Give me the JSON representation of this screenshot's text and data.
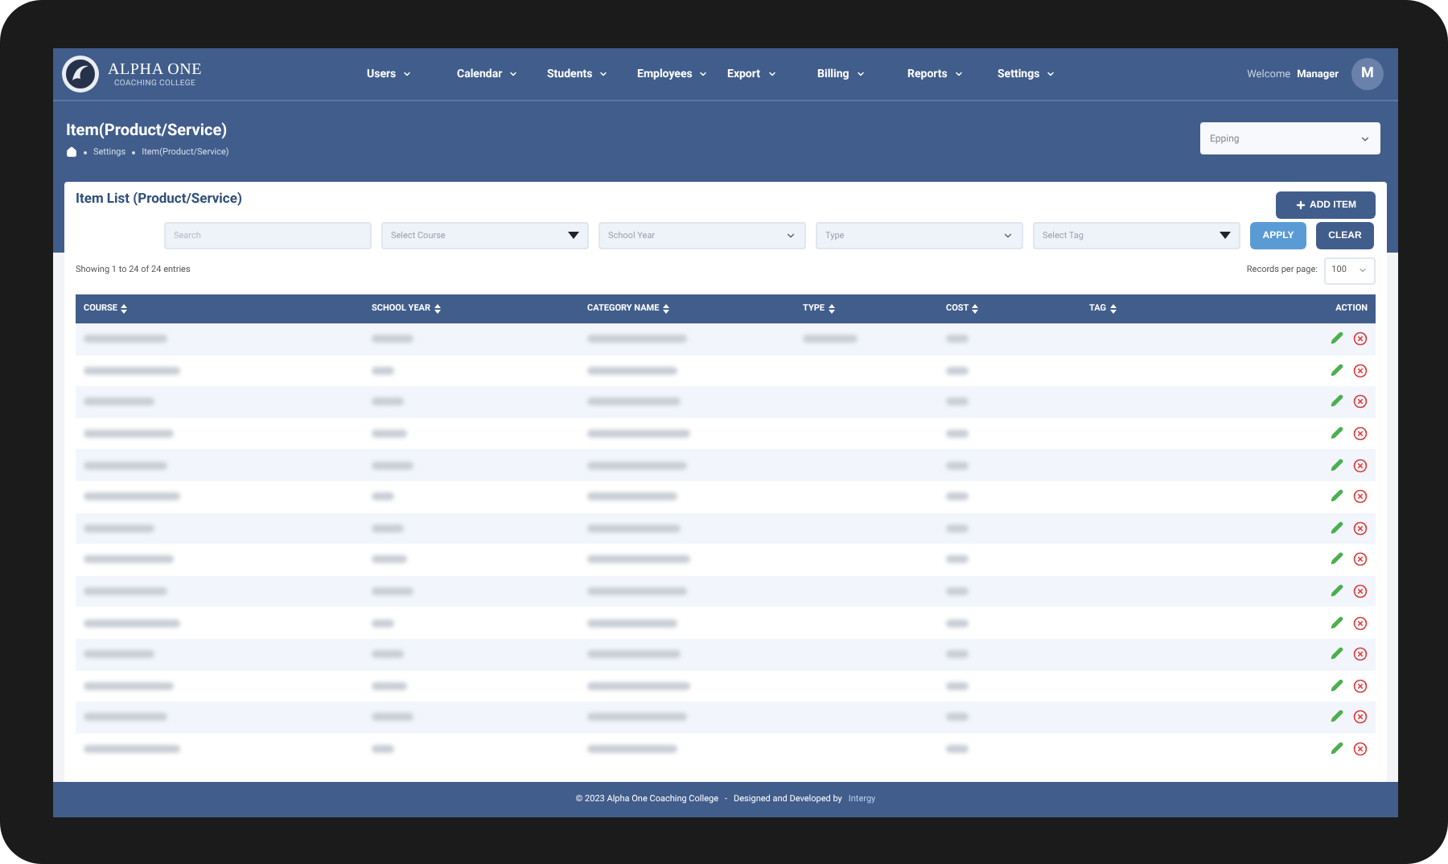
{
  "nav": {
    "brand": "ALPHA ONE",
    "brand_sub": "COACHING COLLEGE",
    "menu": [
      {
        "label": "Users"
      },
      {
        "label": "Calendar"
      },
      {
        "label": "Students"
      },
      {
        "label": "Employees"
      },
      {
        "label": "Export"
      },
      {
        "label": "Billing"
      },
      {
        "label": "Reports"
      },
      {
        "label": "Settings"
      }
    ],
    "welcome": "Welcome",
    "user": "Manager",
    "avatar": "M"
  },
  "page": {
    "title": "Item(Product/Service)",
    "breadcrumb": [
      "Settings",
      "Item(Product/Service)"
    ],
    "location": "Epping"
  },
  "card": {
    "title": "Item List (Product/Service)",
    "add_button": "ADD ITEM",
    "filters": [
      {
        "kind": "input",
        "placeholder": "Search"
      },
      {
        "kind": "solid-select",
        "placeholder": "Select Course"
      },
      {
        "kind": "chevron-select",
        "placeholder": "School Year"
      },
      {
        "kind": "chevron-select",
        "placeholder": "Type"
      },
      {
        "kind": "solid-select",
        "placeholder": "Select Tag"
      }
    ],
    "apply": "APPLY",
    "clear": "CLEAR",
    "showing": "Showing 1 to 24 of 24 entries",
    "records_label": "Records per page:",
    "records_value": "100"
  },
  "table": {
    "columns": [
      {
        "label": "COURSE",
        "sortable": true
      },
      {
        "label": "SCHOOL YEAR",
        "sortable": true
      },
      {
        "label": "CATEGORY NAME",
        "sortable": true
      },
      {
        "label": "TYPE",
        "sortable": true
      },
      {
        "label": "COST",
        "sortable": true
      },
      {
        "label": "TAG",
        "sortable": true
      },
      {
        "label": "ACTION",
        "sortable": false
      }
    ],
    "rows": [
      {
        "cells": [
          {
            "blurred": true
          },
          {
            "blurred": true
          },
          {
            "blurred": true
          },
          {
            "blurred": true
          },
          {
            "blurred": true
          },
          {
            "blurred": false
          }
        ]
      },
      {
        "cells": [
          {
            "blurred": true
          },
          {
            "blurred": true
          },
          {
            "blurred": true
          },
          {
            "blurred": false
          },
          {
            "blurred": true
          },
          {
            "blurred": false
          }
        ]
      },
      {
        "cells": [
          {
            "blurred": true
          },
          {
            "blurred": true
          },
          {
            "blurred": true
          },
          {
            "blurred": false
          },
          {
            "blurred": true
          },
          {
            "blurred": false
          }
        ]
      },
      {
        "cells": [
          {
            "blurred": true
          },
          {
            "blurred": true
          },
          {
            "blurred": true
          },
          {
            "blurred": false
          },
          {
            "blurred": true
          },
          {
            "blurred": false
          }
        ]
      },
      {
        "cells": [
          {
            "blurred": true
          },
          {
            "blurred": true
          },
          {
            "blurred": true
          },
          {
            "blurred": false
          },
          {
            "blurred": true
          },
          {
            "blurred": false
          }
        ]
      },
      {
        "cells": [
          {
            "blurred": true
          },
          {
            "blurred": true
          },
          {
            "blurred": true
          },
          {
            "blurred": false
          },
          {
            "blurred": true
          },
          {
            "blurred": false
          }
        ]
      },
      {
        "cells": [
          {
            "blurred": true
          },
          {
            "blurred": true
          },
          {
            "blurred": true
          },
          {
            "blurred": false
          },
          {
            "blurred": true
          },
          {
            "blurred": false
          }
        ]
      },
      {
        "cells": [
          {
            "blurred": true
          },
          {
            "blurred": true
          },
          {
            "blurred": true
          },
          {
            "blurred": false
          },
          {
            "blurred": true
          },
          {
            "blurred": false
          }
        ]
      },
      {
        "cells": [
          {
            "blurred": true
          },
          {
            "blurred": true
          },
          {
            "blurred": true
          },
          {
            "blurred": false
          },
          {
            "blurred": true
          },
          {
            "blurred": false
          }
        ]
      },
      {
        "cells": [
          {
            "blurred": true
          },
          {
            "blurred": true
          },
          {
            "blurred": true
          },
          {
            "blurred": false
          },
          {
            "blurred": true
          },
          {
            "blurred": false
          }
        ]
      },
      {
        "cells": [
          {
            "blurred": true
          },
          {
            "blurred": true
          },
          {
            "blurred": true
          },
          {
            "blurred": false
          },
          {
            "blurred": true
          },
          {
            "blurred": false
          }
        ]
      },
      {
        "cells": [
          {
            "blurred": true
          },
          {
            "blurred": true
          },
          {
            "blurred": true
          },
          {
            "blurred": false
          },
          {
            "blurred": true
          },
          {
            "blurred": false
          }
        ]
      },
      {
        "cells": [
          {
            "blurred": true
          },
          {
            "blurred": true
          },
          {
            "blurred": true
          },
          {
            "blurred": false
          },
          {
            "blurred": true
          },
          {
            "blurred": false
          }
        ]
      },
      {
        "cells": [
          {
            "blurred": true
          },
          {
            "blurred": true
          },
          {
            "blurred": true
          },
          {
            "blurred": false
          },
          {
            "blurred": true
          },
          {
            "blurred": false
          }
        ]
      }
    ]
  },
  "footer": {
    "copyright": "© 2023 Alpha One Coaching College",
    "separator": "-",
    "credit": "Designed and Developed by",
    "link": "Intergy"
  }
}
